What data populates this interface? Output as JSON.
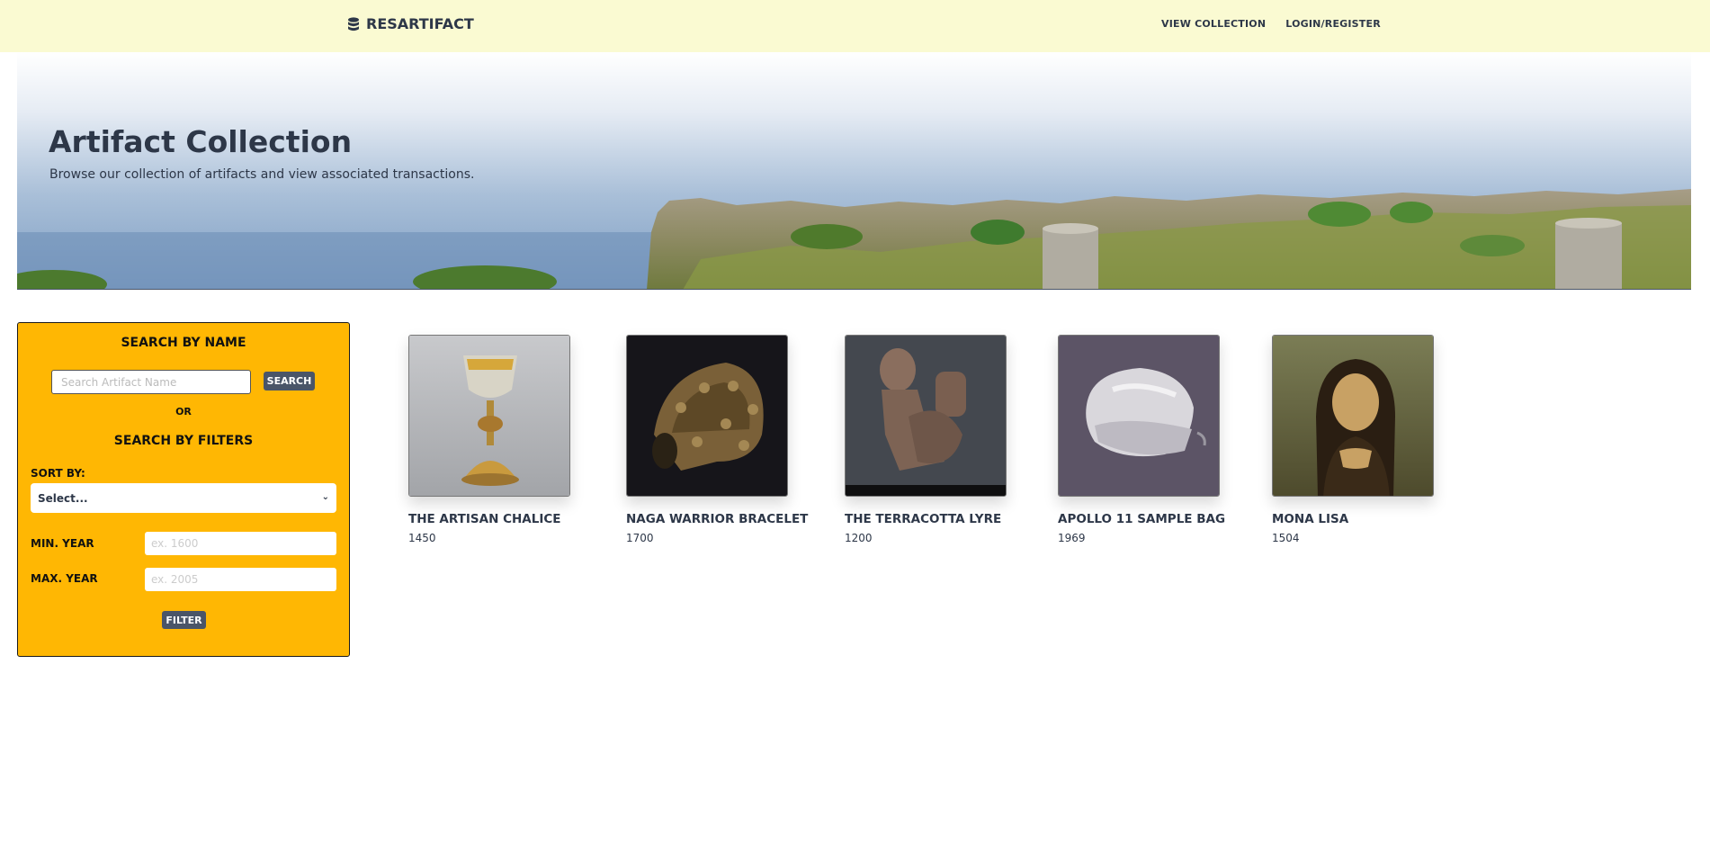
{
  "nav": {
    "brand": "RESARTIFACT",
    "brand_icon": "database-icon",
    "links": [
      "VIEW COLLECTION",
      "LOGIN/REGISTER"
    ]
  },
  "hero": {
    "title": "Artifact Collection",
    "subtitle": "Browse our collection of artifacts and view associated transactions."
  },
  "filters": {
    "name_heading": "SEARCH BY NAME",
    "search_placeholder": "Search Artifact Name",
    "search_button": "SEARCH",
    "or_text": "OR",
    "filters_heading": "SEARCH BY FILTERS",
    "sort_label": "SORT BY:",
    "sort_selected": "Select...",
    "min_year_label": "MIN. YEAR",
    "min_year_placeholder": "ex. 1600",
    "max_year_label": "MAX. YEAR",
    "max_year_placeholder": "ex. 2005",
    "filter_button": "FILTER"
  },
  "artifacts": [
    {
      "name": "THE ARTISAN CHALICE",
      "year": "1450"
    },
    {
      "name": "NAGA WARRIOR BRACELET",
      "year": "1700"
    },
    {
      "name": "THE TERRACOTTA LYRE",
      "year": "1200"
    },
    {
      "name": "APOLLO 11 SAMPLE BAG",
      "year": "1969"
    },
    {
      "name": "MONA LISA",
      "year": "1504"
    }
  ],
  "colors": {
    "navbar_bg": "#fafad2",
    "panel_bg": "#ffb703",
    "button_bg": "#4a5568",
    "text": "#2d3748"
  }
}
